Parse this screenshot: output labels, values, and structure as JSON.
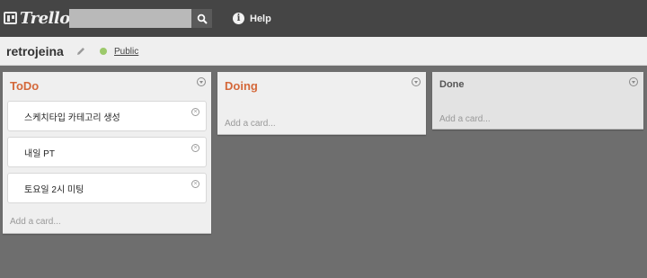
{
  "header": {
    "logo_text": "Trello",
    "search": {
      "value": "",
      "placeholder": ""
    },
    "help_label": "Help"
  },
  "board": {
    "title": "retrojeina",
    "visibility": "Public",
    "visibility_color": "#9cc96b"
  },
  "lists": [
    {
      "title": "ToDo",
      "cards": [
        {
          "label": "스케치타입 카테고리 생성"
        },
        {
          "label": "내일 PT"
        },
        {
          "label": "토요일 2시 미팅"
        }
      ],
      "add_card": "Add a card..."
    },
    {
      "title": "Doing",
      "cards": [],
      "add_card": "Add a card..."
    },
    {
      "title": "Done",
      "cards": [],
      "add_card": "Add a card..."
    }
  ],
  "colors": {
    "topbar": "#454545",
    "canvas": "#6e6e6e",
    "list_title_accent": "#d4683a"
  }
}
